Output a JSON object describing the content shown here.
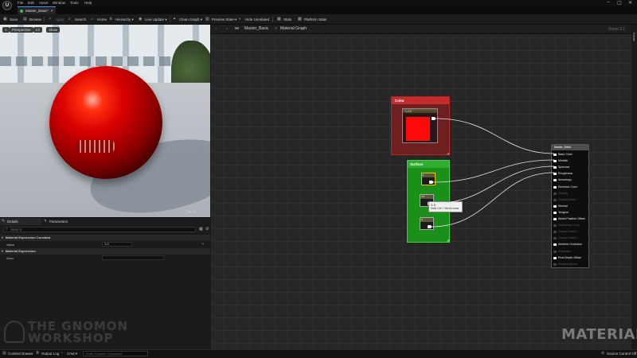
{
  "menubar": {
    "logo": "U",
    "items": [
      "File",
      "Edit",
      "Asset",
      "Window",
      "Tools",
      "Help"
    ],
    "window_controls": [
      "–",
      "▢",
      "✕"
    ]
  },
  "tab": {
    "label": "Master_Basic*",
    "close": "✕"
  },
  "toolbar": {
    "save": "Save",
    "browse": "Browse",
    "apply": "Apply",
    "search": "Search",
    "home": "Home",
    "hierarchy": "Hierarchy",
    "live_update": "Live Update",
    "clean_graph": "Clean Graph",
    "preview_state": "Preview State",
    "hide_unrelated": "Hide Unrelated",
    "stats": "Stats",
    "platform_stats": "Platform Stats"
  },
  "viewport": {
    "mode": "Perspective",
    "view": "Lit",
    "show": "Show"
  },
  "details": {
    "tabs": [
      "Details",
      "Parameters"
    ],
    "search_placeholder": "Search",
    "section1": "Material Expression Constant",
    "value_label": "Value",
    "value": "1.0",
    "section2": "Material Expression",
    "desc_label": "Desc"
  },
  "graph": {
    "crumb_root": "Master_Basic",
    "crumb_sep": ">",
    "crumb_graph": "Material Graph",
    "zoom": "Zoom 1:1",
    "palette": "Palette"
  },
  "nodes": {
    "color_comment": "Color",
    "color_const_label": "1,0,0",
    "surface_comment": "Surface",
    "const_values": [
      "1",
      "0.5",
      "0"
    ],
    "tooltip_value": "0.5",
    "tooltip_hint": "Hold Ctrl + Alt for more",
    "master_title": "Master_Basic"
  },
  "master_pins": [
    {
      "label": "Base Color",
      "active": true
    },
    {
      "label": "Metallic",
      "active": true
    },
    {
      "label": "Specular",
      "active": true
    },
    {
      "label": "Roughness",
      "active": true
    },
    {
      "label": "Anisotropy",
      "active": true
    },
    {
      "label": "Emissive Color",
      "active": true
    },
    {
      "label": "Opacity",
      "active": false
    },
    {
      "label": "Opacity Mask",
      "active": false
    },
    {
      "label": "Normal",
      "active": true
    },
    {
      "label": "Tangent",
      "active": true
    },
    {
      "label": "World Position Offset",
      "active": true
    },
    {
      "label": "Subsurface Color",
      "active": false
    },
    {
      "label": "Custom Data 0",
      "active": false
    },
    {
      "label": "Custom Data 1",
      "active": false
    },
    {
      "label": "Ambient Occlusion",
      "active": true
    },
    {
      "label": "Refraction",
      "active": false
    },
    {
      "label": "Pixel Depth Offset",
      "active": true
    },
    {
      "label": "Shading Model",
      "active": false
    }
  ],
  "watermark": {
    "line1": "THE GNOMON",
    "line2": "WORKSHOP",
    "corner": "MATERIAL"
  },
  "statusbar": {
    "content_drawer": "Content Drawer",
    "output_log": "Output Log",
    "cmd": "Cmd",
    "console_placeholder": "Enter Console Command",
    "source_control": "Source Control Off"
  },
  "colors": {
    "accent": "#4a8ef0",
    "color_node": "#c42b2b",
    "surface_node": "#2fae2f",
    "sphere": "#d80000"
  }
}
